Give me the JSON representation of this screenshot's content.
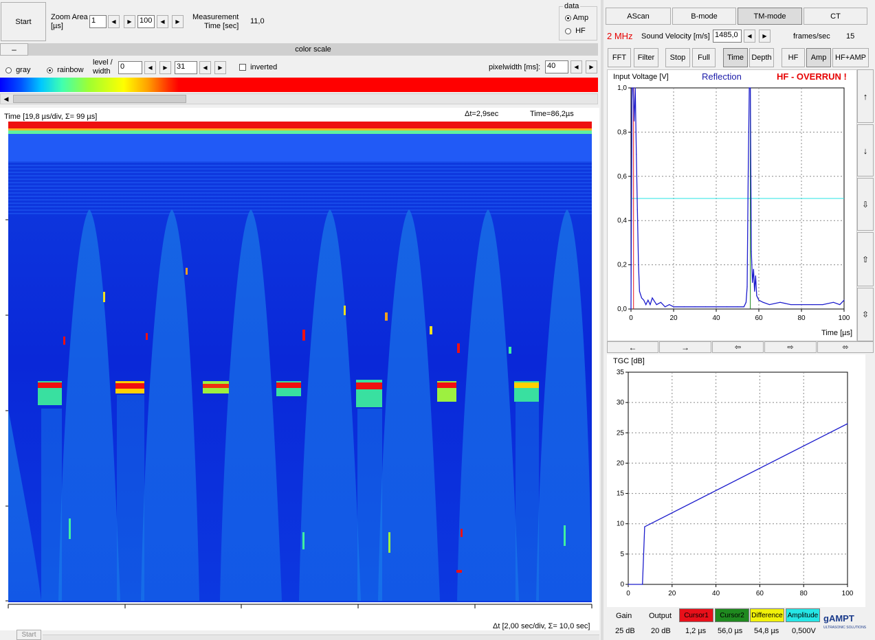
{
  "toolbar": {
    "start_label": "Start",
    "zoom_label_1": "Zoom Area",
    "zoom_label_2": "[µs]",
    "zoom_from": "1",
    "zoom_to": "100",
    "measure_label_1": "Measurement",
    "measure_label_2": "Time [sec]",
    "measure_value": "11,0",
    "data_group_label": "data",
    "data_amp": "Amp",
    "data_hf": "HF",
    "data_selected": "Amp"
  },
  "colorscale": {
    "collapse_label": "–",
    "title": "color scale",
    "gray_label": "gray",
    "rainbow_label": "rainbow",
    "selected": "rainbow",
    "level_label_1": "level /",
    "level_label_2": "width",
    "level_value": "0",
    "width_value": "31",
    "inverted_label": "inverted",
    "pixelwidth_label": "pixelwidth [ms]:",
    "pixelwidth_value": "40"
  },
  "mmode": {
    "time_header": "Time   [19,8 µs/div, Σ= 99 µs]",
    "delta_t": "Δt=2,9sec",
    "time_cursor": "Time=86,2µs",
    "footer": "Δt  [2,00 sec/div, Σ= 10,0 sec]",
    "bottom_start": "Start"
  },
  "modes": {
    "tabs": [
      "AScan",
      "B-mode",
      "TM-mode",
      "CT"
    ],
    "active_tab": "TM-mode",
    "frequency": "2 MHz",
    "sound_velocity_label": "Sound Velocity [m/s]",
    "sound_velocity_value": "1485,0",
    "frames_label": "frames/sec",
    "frames_value": "15",
    "buttons": [
      "FFT",
      "Filter",
      "Stop",
      "Full",
      "Time",
      "Depth",
      "HF",
      "Amp",
      "HF+AMP"
    ],
    "pressed_buttons": [
      "Time",
      "Amp"
    ]
  },
  "ascan": {
    "ylabel": "Input Voltage [V]",
    "mode_label": "Reflection",
    "warning": "HF - OVERRUN !",
    "xlabel": "Time [µs]",
    "side_icons": [
      "arrow-up-icon",
      "arrow-down-icon",
      "hollow-arrow-down-icon",
      "hollow-arrow-up-icon",
      "hollow-arrow-updown-icon"
    ],
    "nav_icons": [
      "arrow-left-icon",
      "arrow-right-icon",
      "hollow-arrow-left-icon",
      "hollow-arrow-right-icon",
      "hollow-arrow-leftright-icon"
    ]
  },
  "tgc": {
    "ylabel": "TGC [dB]"
  },
  "status": {
    "gain_label": "Gain",
    "gain_value": "25 dB",
    "output_label": "Output",
    "output_value": "20 dB",
    "cursor1_label": "Cursor1",
    "cursor1_value": "1,2 µs",
    "cursor2_label": "Cursor2",
    "cursor2_value": "56,0 µs",
    "difference_label": "Difference",
    "difference_value": "54,8 µs",
    "amplitude_label": "Amplitude",
    "amplitude_value": "0,500V",
    "logo": "gAMPT",
    "logo_sub": "ULTRASONIC SOLUTIONS"
  },
  "colors": {
    "cursor1": "#e8101a",
    "cursor2": "#1f8a1f",
    "difference": "#f2f20a",
    "amplitude": "#26e6e6",
    "frequency": "#e60000",
    "warning": "#e60000",
    "reflection": "#1a1aa8",
    "trace": "#1c1ccc"
  },
  "chart_data": [
    {
      "type": "line",
      "title": "",
      "xlabel": "Time [µs]",
      "ylabel": "Input Voltage [V]",
      "xlim": [
        0,
        100
      ],
      "ylim": [
        0,
        1.0
      ],
      "xticks": [
        "0",
        "20",
        "40",
        "60",
        "80",
        "100"
      ],
      "yticks": [
        "0,0",
        "0,2",
        "0,4",
        "0,6",
        "0,8",
        "1,0"
      ],
      "grid": true,
      "amplitude_threshold": 0.5,
      "cursor1_x": 1.2,
      "cursor2_x": 56.0,
      "series": [
        {
          "x": [
            0,
            0.5,
            1,
            1.5,
            2,
            2.5,
            3,
            3.5,
            4,
            5,
            6,
            7,
            8,
            9,
            10,
            12,
            14,
            16,
            18,
            20,
            25,
            30,
            35,
            40,
            45,
            50,
            53,
            54,
            54.5,
            55,
            55.5,
            56,
            56.5,
            57,
            57.5,
            58,
            58.5,
            59,
            60,
            62,
            65,
            70,
            75,
            80,
            85,
            90,
            95,
            98,
            100
          ],
          "y": [
            0.0,
            1.0,
            1.0,
            0.85,
            1.0,
            0.7,
            0.45,
            0.2,
            0.08,
            0.05,
            0.04,
            0.02,
            0.04,
            0.02,
            0.05,
            0.02,
            0.03,
            0.01,
            0.02,
            0.01,
            0.01,
            0.01,
            0.01,
            0.01,
            0.01,
            0.01,
            0.01,
            0.03,
            0.1,
            0.6,
            1.0,
            1.0,
            0.26,
            0.12,
            0.18,
            0.08,
            0.15,
            0.06,
            0.04,
            0.03,
            0.02,
            0.03,
            0.02,
            0.02,
            0.02,
            0.02,
            0.03,
            0.02,
            0.04
          ]
        }
      ]
    },
    {
      "type": "line",
      "title": "",
      "xlabel": "",
      "ylabel": "TGC [dB]",
      "xlim": [
        0,
        100
      ],
      "ylim": [
        0,
        35
      ],
      "xticks": [
        "0",
        "20",
        "40",
        "60",
        "80",
        "100"
      ],
      "yticks": [
        "0",
        "5",
        "10",
        "15",
        "20",
        "25",
        "30",
        "35"
      ],
      "grid": true,
      "series": [
        {
          "x": [
            0,
            6.5,
            7.5,
            100
          ],
          "y": [
            0,
            0,
            9.5,
            26.5
          ]
        }
      ]
    }
  ]
}
